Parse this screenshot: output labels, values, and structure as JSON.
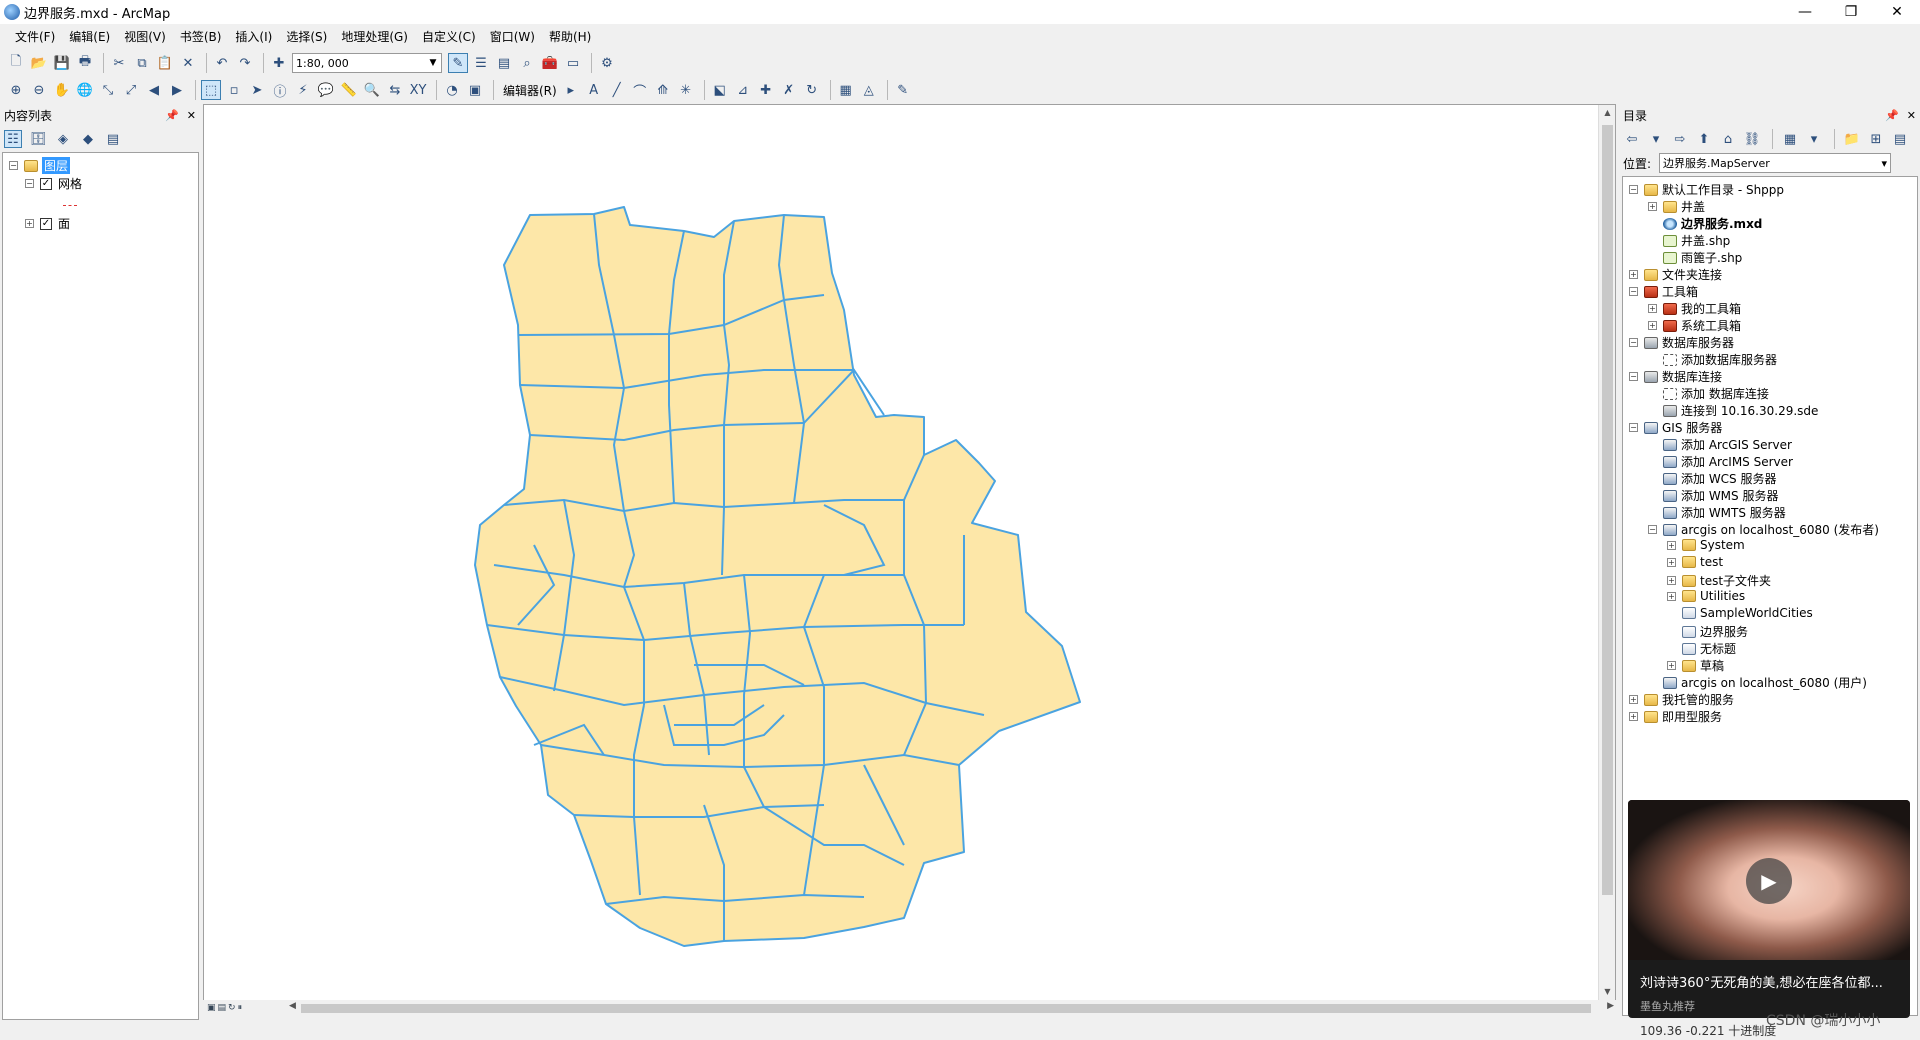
{
  "window": {
    "title": "边界服务.mxd - ArcMap",
    "minimize": "—",
    "maximize": "❐",
    "close": "✕"
  },
  "menu": [
    "文件(F)",
    "编辑(E)",
    "视图(V)",
    "书签(B)",
    "插入(I)",
    "选择(S)",
    "地理处理(G)",
    "自定义(C)",
    "窗口(W)",
    "帮助(H)"
  ],
  "toolbar": {
    "scale": "1:80, 000",
    "editor_label": "编辑器(R)"
  },
  "toc": {
    "title": "内容列表",
    "root": "图层",
    "layers": [
      {
        "name": "网格",
        "checked": true,
        "expanded": true
      },
      {
        "name": "面",
        "checked": true,
        "expanded": false
      }
    ]
  },
  "catalog": {
    "title": "目录",
    "location_label": "位置:",
    "location_value": "边界服务.MapServer",
    "items": [
      {
        "label": "默认工作目录 - Shppp",
        "level": 0,
        "icon": "folder",
        "exp": "−"
      },
      {
        "label": "井盖",
        "level": 1,
        "icon": "folder",
        "exp": "+"
      },
      {
        "label": "边界服务.mxd",
        "level": 1,
        "icon": "mxd",
        "exp": "",
        "bold": true
      },
      {
        "label": "井盖.shp",
        "level": 1,
        "icon": "shp",
        "exp": ""
      },
      {
        "label": "雨篦子.shp",
        "level": 1,
        "icon": "shp",
        "exp": ""
      },
      {
        "label": "文件夹连接",
        "level": 0,
        "icon": "folder",
        "exp": "+"
      },
      {
        "label": "工具箱",
        "level": 0,
        "icon": "toolbox",
        "exp": "−"
      },
      {
        "label": "我的工具箱",
        "level": 1,
        "icon": "toolbox",
        "exp": "+"
      },
      {
        "label": "系统工具箱",
        "level": 1,
        "icon": "toolbox",
        "exp": "+"
      },
      {
        "label": "数据库服务器",
        "level": 0,
        "icon": "db",
        "exp": "−"
      },
      {
        "label": "添加数据库服务器",
        "level": 1,
        "icon": "add",
        "exp": ""
      },
      {
        "label": "数据库连接",
        "level": 0,
        "icon": "db",
        "exp": "−"
      },
      {
        "label": "添加 数据库连接",
        "level": 1,
        "icon": "add",
        "exp": ""
      },
      {
        "label": "连接到 10.16.30.29.sde",
        "level": 1,
        "icon": "db",
        "exp": ""
      },
      {
        "label": "GIS 服务器",
        "level": 0,
        "icon": "server",
        "exp": "−"
      },
      {
        "label": "添加 ArcGIS Server",
        "level": 1,
        "icon": "server",
        "exp": ""
      },
      {
        "label": "添加 ArcIMS Server",
        "level": 1,
        "icon": "server",
        "exp": ""
      },
      {
        "label": "添加 WCS 服务器",
        "level": 1,
        "icon": "server",
        "exp": ""
      },
      {
        "label": "添加 WMS 服务器",
        "level": 1,
        "icon": "server",
        "exp": ""
      },
      {
        "label": "添加 WMTS 服务器",
        "level": 1,
        "icon": "server",
        "exp": ""
      },
      {
        "label": "arcgis on localhost_6080 (发布者)",
        "level": 1,
        "icon": "server",
        "exp": "−"
      },
      {
        "label": "System",
        "level": 2,
        "icon": "folder",
        "exp": "+"
      },
      {
        "label": "test",
        "level": 2,
        "icon": "folder",
        "exp": "+"
      },
      {
        "label": "test子文件夹",
        "level": 2,
        "icon": "folder",
        "exp": "+"
      },
      {
        "label": "Utilities",
        "level": 2,
        "icon": "folder",
        "exp": "+"
      },
      {
        "label": "SampleWorldCities",
        "level": 2,
        "icon": "service",
        "exp": ""
      },
      {
        "label": "边界服务",
        "level": 2,
        "icon": "service",
        "exp": ""
      },
      {
        "label": "无标题",
        "level": 2,
        "icon": "service",
        "exp": ""
      },
      {
        "label": "草稿",
        "level": 2,
        "icon": "folder",
        "exp": "+"
      },
      {
        "label": "arcgis on localhost_6080 (用户)",
        "level": 1,
        "icon": "server",
        "exp": ""
      },
      {
        "label": "我托管的服务",
        "level": 0,
        "icon": "folder",
        "exp": "+"
      },
      {
        "label": "即用型服务",
        "level": 0,
        "icon": "folder",
        "exp": "+"
      }
    ]
  },
  "ad": {
    "caption": "刘诗诗360°无死角的美,想必在座各位都...",
    "source": "墨鱼丸推荐",
    "play": "▶"
  },
  "watermark": "CSDN @瑞小小小",
  "status": {
    "coords": "109.36  -0.221 十进制度"
  },
  "colors": {
    "polygon_fill": "#fde7a8",
    "polygon_stroke": "#4aa3e0",
    "selection": "#3399ff"
  }
}
